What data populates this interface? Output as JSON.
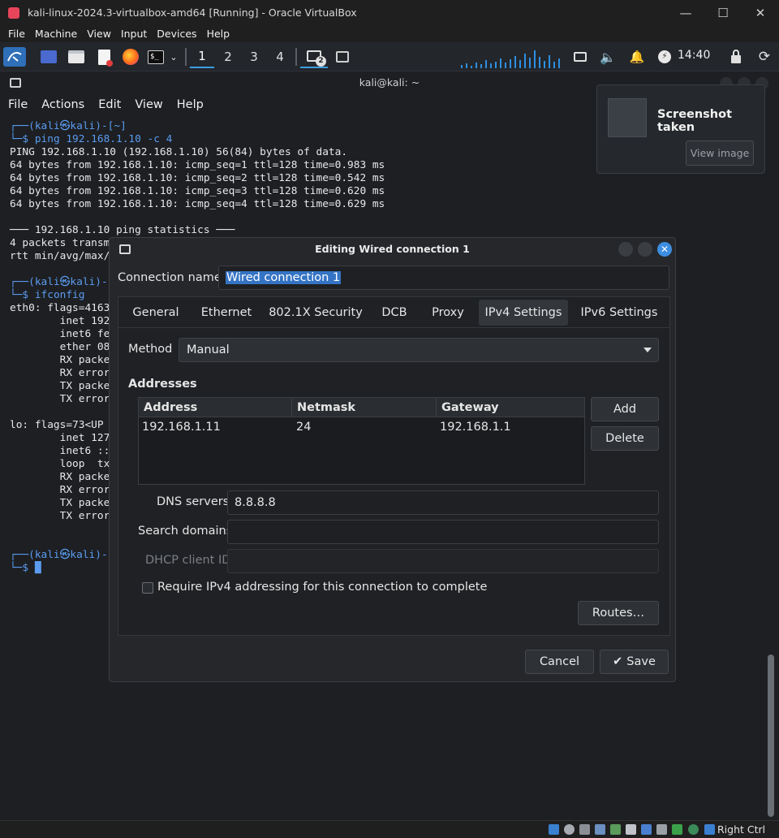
{
  "host": {
    "title": "kali-linux-2024.3-virtualbox-amd64 [Running] - Oracle VirtualBox",
    "menu": [
      "File",
      "Machine",
      "View",
      "Input",
      "Devices",
      "Help"
    ],
    "host_key": "Right Ctrl"
  },
  "panel": {
    "workspaces": [
      "1",
      "2",
      "3",
      "4"
    ],
    "active_workspace": "1",
    "window_badge": "2",
    "clock": "14:40"
  },
  "terminal": {
    "title": "kali@kali: ~",
    "menu": [
      "File",
      "Actions",
      "Edit",
      "View",
      "Help"
    ],
    "lines": [
      "┌──(kali㉿kali)-[~]",
      "└─$ ping 192.168.1.10 -c 4",
      "PING 192.168.1.10 (192.168.1.10) 56(84) bytes of data.",
      "64 bytes from 192.168.1.10: icmp_seq=1 ttl=128 time=0.983 ms",
      "64 bytes from 192.168.1.10: icmp_seq=2 ttl=128 time=0.542 ms",
      "64 bytes from 192.168.1.10: icmp_seq=3 ttl=128 time=0.620 ms",
      "64 bytes from 192.168.1.10: icmp_seq=4 ttl=128 time=0.629 ms",
      "",
      "─── 192.168.1.10 ping statistics ───",
      "4 packets transm",
      "rtt min/avg/max/",
      "",
      "┌──(kali㉿kali)-",
      "└─$ ifconfig",
      "eth0: flags=4163",
      "        inet 192",
      "        inet6 fe",
      "        ether 08",
      "        RX packe",
      "        RX error",
      "        TX packe",
      "        TX error",
      "",
      "lo: flags=73<UP",
      "        inet 127",
      "        inet6 ::",
      "        loop  tx",
      "        RX packe",
      "        RX error",
      "        TX packe",
      "        TX error",
      "",
      "",
      "┌──(kali㉿kali)-",
      "└─$ █"
    ]
  },
  "notification": {
    "title": "Screenshot taken",
    "button": "View image"
  },
  "dialog": {
    "title": "Editing Wired connection 1",
    "connection_name_label": "Connection name",
    "connection_name": "Wired connection 1",
    "tabs": [
      "General",
      "Ethernet",
      "802.1X Security",
      "DCB",
      "Proxy",
      "IPv4 Settings",
      "IPv6 Settings"
    ],
    "active_tab": "IPv4 Settings",
    "method_label": "Method",
    "method_value": "Manual",
    "addresses_label": "Addresses",
    "address_columns": [
      "Address",
      "Netmask",
      "Gateway"
    ],
    "addresses": [
      {
        "address": "192.168.1.11",
        "netmask": "24",
        "gateway": "192.168.1.1"
      }
    ],
    "add_button": "Add",
    "delete_button": "Delete",
    "dns_label": "DNS servers",
    "dns_value": "8.8.8.8",
    "search_domains_label": "Search domains",
    "search_domains_value": "",
    "dhcp_client_id_label": "DHCP client ID",
    "dhcp_client_id_value": "",
    "require_ipv4_label": "Require IPv4 addressing for this connection to complete",
    "require_ipv4_checked": false,
    "routes_button": "Routes…",
    "cancel_button": "Cancel",
    "save_button": "Save"
  },
  "colors": {
    "accent": "#3d8de0",
    "selection": "#3574c4",
    "prompt": "#5b9cf0"
  }
}
